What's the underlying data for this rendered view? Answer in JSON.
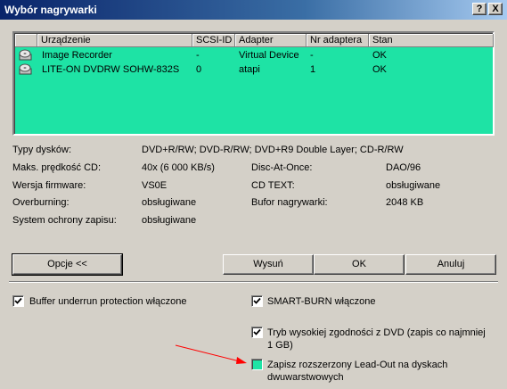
{
  "window": {
    "title": "Wybór nagrywarki",
    "help_label": "?",
    "close_label": "X"
  },
  "list": {
    "columns": [
      "Urządzenie",
      "SCSI-ID",
      "Adapter",
      "Nr adaptera",
      "Stan"
    ],
    "rows": [
      {
        "device": "Image Recorder",
        "scsi": "-",
        "adapter": "Virtual Device",
        "adapter_no": "-",
        "status": "OK",
        "icon": "disc-drive-icon"
      },
      {
        "device": "LITE-ON  DVDRW SOHW-832S",
        "scsi": "0",
        "adapter": "atapi",
        "adapter_no": "1",
        "status": "OK",
        "icon": "disc-drive-icon"
      }
    ],
    "bg_color": "#1ee3a5"
  },
  "info": {
    "disc_types_label": "Typy dysków:",
    "disc_types_value": "DVD+R/RW; DVD-R/RW; DVD+R9 Double Layer; CD-R/RW",
    "max_speed_label": "Maks. prędkość CD:",
    "max_speed_value": "40x (6 000 KB/s)",
    "dao_label": "Disc-At-Once:",
    "dao_value": "DAO/96",
    "firmware_label": "Wersja firmware:",
    "firmware_value": "VS0E",
    "cdtext_label": "CD TEXT:",
    "cdtext_value": "obsługiwane",
    "overburn_label": "Overburning:",
    "overburn_value": "obsługiwane",
    "buffer_label": "Bufor nagrywarki:",
    "buffer_value": "2048 KB",
    "protect_label": "System ochrony zapisu:",
    "protect_value": "obsługiwane"
  },
  "buttons": {
    "options": "Opcje <<",
    "eject": "Wysuń",
    "ok": "OK",
    "cancel": "Anuluj"
  },
  "options": {
    "buffer_underrun": {
      "label": "Buffer underrun protection włączone",
      "checked": true
    },
    "smart_burn": {
      "label": "SMART-BURN włączone",
      "checked": true
    },
    "dvd_compat": {
      "label": "Tryb wysokiej zgodności z DVD (zapis co najmniej 1 GB)",
      "checked": true
    },
    "leadout": {
      "label": "Zapisz rozszerzony Lead-Out na dyskach dwuwarstwowych",
      "checked": false
    }
  },
  "annotation_arrow_color": "#ff0000"
}
